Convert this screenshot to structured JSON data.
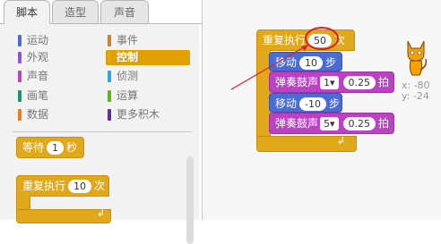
{
  "tabs": [
    "脚本",
    "造型",
    "声音"
  ],
  "categories_left": [
    {
      "label": "运动",
      "color": "#4a6cd4"
    },
    {
      "label": "外观",
      "color": "#8a55d7"
    },
    {
      "label": "声音",
      "color": "#bb42c3"
    },
    {
      "label": "画笔",
      "color": "#0e9a6c"
    },
    {
      "label": "数据",
      "color": "#ee7d16"
    }
  ],
  "categories_right": [
    {
      "label": "事件",
      "color": "#c88330"
    },
    {
      "label": "控制",
      "color": "#e1a91a"
    },
    {
      "label": "侦测",
      "color": "#2ca5e2"
    },
    {
      "label": "运算",
      "color": "#5cb712"
    },
    {
      "label": "更多积木",
      "color": "#632d99"
    }
  ],
  "palette_blocks": {
    "wait": {
      "label": "等待",
      "value": "1",
      "unit": "秒"
    },
    "repeat": {
      "label": "重复执行",
      "value": "10",
      "unit": "次"
    }
  },
  "script": {
    "repeat": {
      "label": "重复执行",
      "value": "50",
      "unit": "次"
    },
    "move1": {
      "label": "移动",
      "value": "10",
      "unit": "步"
    },
    "drum1": {
      "label": "弹奏鼓声",
      "drum": "1",
      "beats": "0.25",
      "unit": "拍"
    },
    "move2": {
      "label": "移动",
      "value": "-10",
      "unit": "步"
    },
    "drum2": {
      "label": "弹奏鼓声",
      "drum": "5",
      "beats": "0.25",
      "unit": "拍"
    }
  },
  "sprite_info": {
    "x": "x: -80",
    "y": "y: -24"
  },
  "colors": {
    "control": "#e1a91a",
    "motion": "#4a6cd4",
    "sound": "#bb42c3",
    "annotation": "#e02020"
  }
}
